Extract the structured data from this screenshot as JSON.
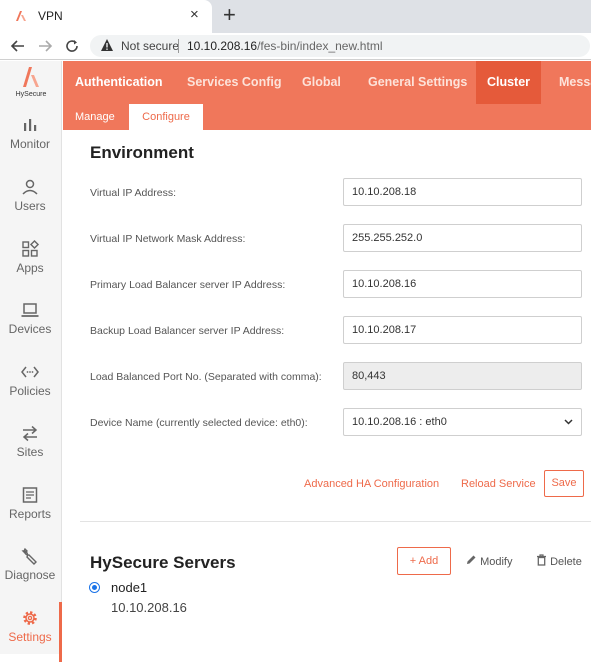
{
  "browser": {
    "tab_title": "VPN",
    "tab_close": "×",
    "new_tab": "+",
    "not_secure": "Not secure",
    "url_host": "10.10.208.16",
    "url_path": "/fes-bin/index_new.html"
  },
  "sidebar": {
    "brand": "HySecure",
    "items": [
      {
        "label": "Monitor",
        "icon": "bar-chart-icon"
      },
      {
        "label": "Users",
        "icon": "user-icon"
      },
      {
        "label": "Apps",
        "icon": "apps-icon"
      },
      {
        "label": "Devices",
        "icon": "laptop-icon"
      },
      {
        "label": "Policies",
        "icon": "code-arrows-icon"
      },
      {
        "label": "Sites",
        "icon": "swap-arrows-icon"
      },
      {
        "label": "Reports",
        "icon": "report-icon"
      },
      {
        "label": "Diagnose",
        "icon": "wrench-icon"
      },
      {
        "label": "Settings",
        "icon": "gear-icon"
      }
    ],
    "active": "Settings"
  },
  "topnav": {
    "items": [
      "Authentication",
      "Services Config",
      "Global",
      "General Settings",
      "Cluster",
      "Messa"
    ],
    "active": "Cluster"
  },
  "subnav": {
    "items": [
      "Manage",
      "Configure"
    ],
    "active": "Configure"
  },
  "environment": {
    "heading": "Environment",
    "fields": [
      {
        "label": "Virtual IP Address:",
        "value": "10.10.208.18"
      },
      {
        "label": "Virtual IP Network Mask Address:",
        "value": "255.255.252.0"
      },
      {
        "label": "Primary Load Balancer server IP Address:",
        "value": "10.10.208.16"
      },
      {
        "label": "Backup Load Balancer server IP Address:",
        "value": "10.10.208.17"
      },
      {
        "label": "Load Balanced Port No. (Separated with comma):",
        "value": "80,443"
      },
      {
        "label": "Device Name (currently selected device: eth0):",
        "value": "10.10.208.16 : eth0"
      }
    ],
    "advanced_link": "Advanced HA Configuration",
    "reload_link": "Reload Service",
    "save_label": "Save"
  },
  "servers": {
    "heading": "HySecure Servers",
    "add_label": "Add",
    "modify_label": "Modify",
    "delete_label": "Delete",
    "nodes": [
      {
        "name": "node1",
        "ip": "10.10.208.16"
      }
    ]
  },
  "colors": {
    "accent": "#f0775b",
    "accent_dark": "#e55a3a",
    "radio": "#1a73e8"
  }
}
